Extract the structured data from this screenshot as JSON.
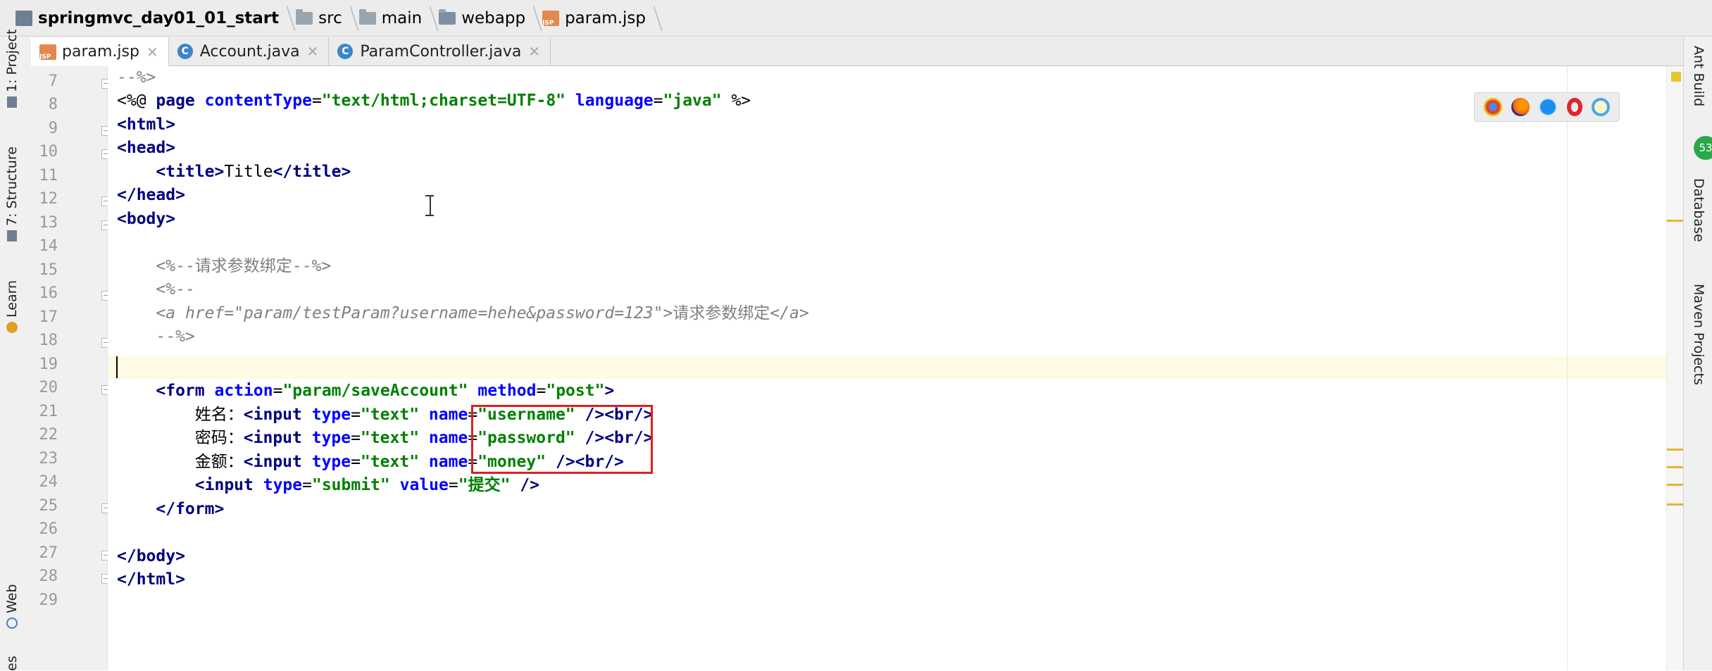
{
  "breadcrumb": [
    "springmvc_day01_01_start",
    "src",
    "main",
    "webapp",
    "param.jsp"
  ],
  "tabs": [
    {
      "label": "param.jsp",
      "icon": "jsp-file-icon",
      "active": true
    },
    {
      "label": "Account.java",
      "icon": "class-icon",
      "active": false
    },
    {
      "label": "ParamController.java",
      "icon": "class-icon",
      "active": false
    }
  ],
  "left_tools": [
    "1: Project",
    "7: Structure",
    "Learn",
    "Web",
    "es"
  ],
  "right_tools": [
    "Ant Build",
    "Database",
    "Maven Projects"
  ],
  "right_badge": "53",
  "browser_icons": [
    "chrome-icon",
    "firefox-icon",
    "safari-icon",
    "opera-icon",
    "ie-icon"
  ],
  "line_numbers": [
    "7",
    "8",
    "9",
    "10",
    "11",
    "12",
    "13",
    "14",
    "15",
    "16",
    "17",
    "18",
    "19",
    "20",
    "21",
    "22",
    "23",
    "24",
    "25",
    "26",
    "27",
    "28",
    "29"
  ],
  "code": {
    "l7": "--%>",
    "l8": {
      "open": "<%@ ",
      "page": "page ",
      "a1": "contentType",
      "eq": "=",
      "v1": "\"text/html;charset=UTF-8\"",
      "a2": " language",
      "v2": "\"java\"",
      "close": " %>"
    },
    "l9": "<html>",
    "l10": "<head>",
    "l11": {
      "open": "<title>",
      "text": "Title",
      "close": "</title>"
    },
    "l12": "</head>",
    "l13": "<body>",
    "l15": "<%--请求参数绑定--%>",
    "l16": "<%--",
    "l17": {
      "open": "<a ",
      "attr": "href=\"param/testParam?username=hehe&password=123\"",
      "text": ">请求参数绑定",
      "close": "</a>"
    },
    "l18": "--%>",
    "l20": {
      "open": "<form ",
      "a1": "action",
      "v1": "\"param/saveAccount\"",
      "a2": " method",
      "v2": "\"post\"",
      "close": ">"
    },
    "l21": {
      "label": "姓名：",
      "v_name": "\"username\""
    },
    "l22": {
      "label": "密码：",
      "v_name": "\"password\""
    },
    "l23": {
      "label": "金额：",
      "v_name": "\"money\""
    },
    "l24": {
      "v_type": "\"submit\"",
      "v_value": "\"提交\""
    },
    "l25": "</form>",
    "l27": "</body>",
    "l28": "</html>"
  }
}
